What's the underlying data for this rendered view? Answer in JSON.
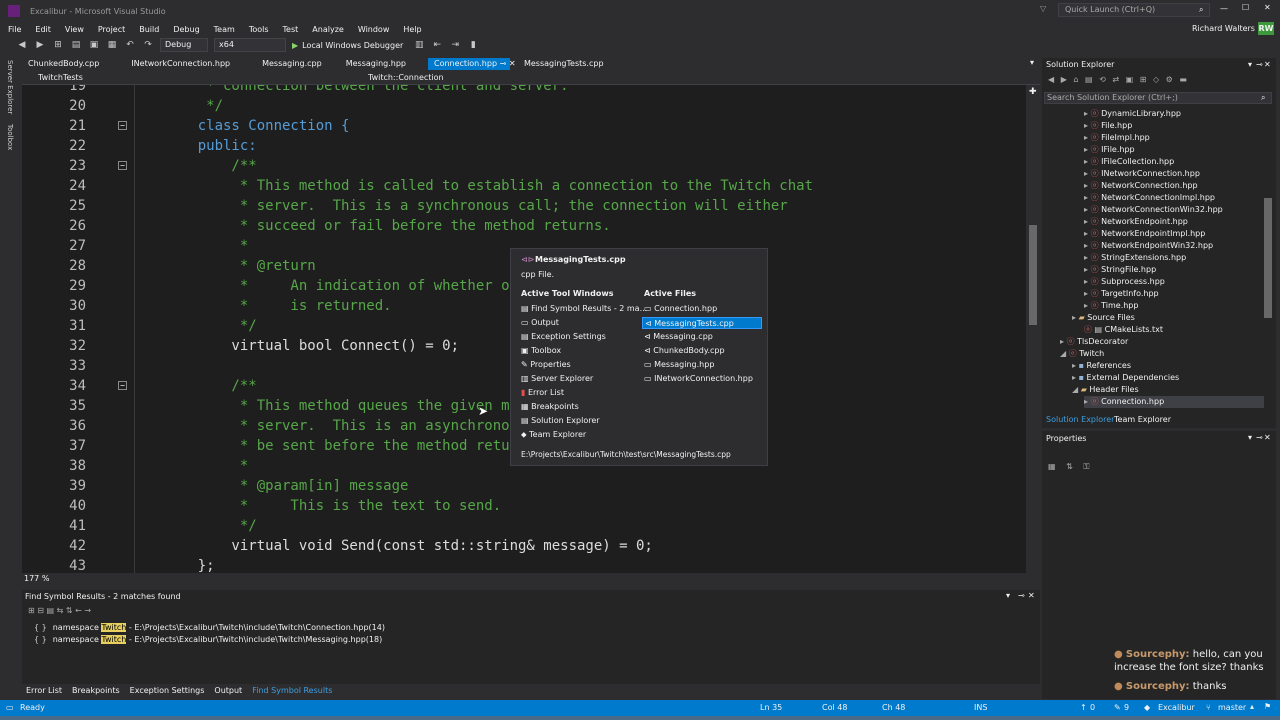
{
  "window": {
    "title": "Excalibur - Microsoft Visual Studio",
    "quick_launch": "Quick Launch (Ctrl+Q)",
    "user": "Richard Walters",
    "user_initials": "RW"
  },
  "menu": [
    "File",
    "Edit",
    "View",
    "Project",
    "Build",
    "Debug",
    "Team",
    "Tools",
    "Test",
    "Analyze",
    "Window",
    "Help"
  ],
  "toolbar": {
    "config": "Debug",
    "platform": "x64",
    "run": "Local Windows Debugger"
  },
  "left_strip": [
    "Server Explorer",
    "Toolbox"
  ],
  "doc_tabs": [
    {
      "label": "ChunkedBody.cpp",
      "active": false
    },
    {
      "label": "INetworkConnection.hpp",
      "active": false
    },
    {
      "label": "Messaging.cpp",
      "active": false
    },
    {
      "label": "Messaging.hpp",
      "active": false
    },
    {
      "label": "Connection.hpp",
      "active": true
    },
    {
      "label": "MessagingTests.cpp",
      "active": false
    }
  ],
  "nav": {
    "project": "TwitchTests",
    "scope": "Twitch::Connection"
  },
  "editor_lines": [
    {
      "n": "19",
      "t": "     * connection between the client and server."
    },
    {
      "n": "20",
      "t": "     */"
    },
    {
      "n": "21",
      "t": "    class Connection {"
    },
    {
      "n": "22",
      "t": "    public:"
    },
    {
      "n": "23",
      "t": "        /**"
    },
    {
      "n": "24",
      "t": "         * This method is called to establish a connection to the Twitch chat"
    },
    {
      "n": "25",
      "t": "         * server.  This is a synchronous call; the connection will either"
    },
    {
      "n": "26",
      "t": "         * succeed or fail before the method returns."
    },
    {
      "n": "27",
      "t": "         *"
    },
    {
      "n": "28",
      "t": "         * @return"
    },
    {
      "n": "29",
      "t": "         *     An indication of whether or no"
    },
    {
      "n": "30",
      "t": "         *     is returned."
    },
    {
      "n": "31",
      "t": "         */"
    },
    {
      "n": "32",
      "t": "        virtual bool Connect() = 0;"
    },
    {
      "n": "33",
      "t": ""
    },
    {
      "n": "34",
      "t": "        /**"
    },
    {
      "n": "35",
      "t": "         * This method queues the given messa"
    },
    {
      "n": "36",
      "t": "         * server.  This is an asynchronous c"
    },
    {
      "n": "37",
      "t": "         * be sent before the method returns."
    },
    {
      "n": "38",
      "t": "         *"
    },
    {
      "n": "39",
      "t": "         * @param[in] message"
    },
    {
      "n": "40",
      "t": "         *     This is the text to send."
    },
    {
      "n": "41",
      "t": "         */"
    },
    {
      "n": "42",
      "t": "        virtual void Send(const std::string& message) = 0;"
    },
    {
      "n": "43",
      "t": "    };"
    }
  ],
  "zoom": "177 %",
  "find_results": {
    "title": "Find Symbol Results - 2 matches found",
    "rows": [
      {
        "pre": "namespace ",
        "hl": "Twitch",
        "post": " - E:\\Projects\\Excalibur\\Twitch\\include\\Twitch\\Connection.hpp(14)"
      },
      {
        "pre": "namespace ",
        "hl": "Twitch",
        "post": " - E:\\Projects\\Excalibur\\Twitch\\include\\Twitch\\Messaging.hpp(18)"
      }
    ]
  },
  "bottom_tabs": [
    "Error List",
    "Breakpoints",
    "Exception Settings",
    "Output",
    "Find Symbol Results"
  ],
  "solution_explorer": {
    "title": "Solution Explorer",
    "search": "Search Solution Explorer (Ctrl+;)",
    "items": [
      {
        "label": "DynamicLibrary.hpp",
        "indent": 4
      },
      {
        "label": "File.hpp",
        "indent": 4
      },
      {
        "label": "FileImpl.hpp",
        "indent": 4
      },
      {
        "label": "IFile.hpp",
        "indent": 4
      },
      {
        "label": "IFileCollection.hpp",
        "indent": 4
      },
      {
        "label": "INetworkConnection.hpp",
        "indent": 4
      },
      {
        "label": "NetworkConnection.hpp",
        "indent": 4
      },
      {
        "label": "NetworkConnectionImpl.hpp",
        "indent": 4
      },
      {
        "label": "NetworkConnectionWin32.hpp",
        "indent": 4
      },
      {
        "label": "NetworkEndpoint.hpp",
        "indent": 4
      },
      {
        "label": "NetworkEndpointImpl.hpp",
        "indent": 4
      },
      {
        "label": "NetworkEndpointWin32.hpp",
        "indent": 4
      },
      {
        "label": "StringExtensions.hpp",
        "indent": 4
      },
      {
        "label": "StringFile.hpp",
        "indent": 4
      },
      {
        "label": "Subprocess.hpp",
        "indent": 4
      },
      {
        "label": "TargetInfo.hpp",
        "indent": 4
      },
      {
        "label": "Time.hpp",
        "indent": 4
      },
      {
        "label": "Source Files",
        "indent": 3
      },
      {
        "label": "CMakeLists.txt",
        "indent": 3
      },
      {
        "label": "TlsDecorator",
        "indent": 2
      },
      {
        "label": "Twitch",
        "indent": 2
      },
      {
        "label": "References",
        "indent": 3
      },
      {
        "label": "External Dependencies",
        "indent": 3
      },
      {
        "label": "Header Files",
        "indent": 3
      },
      {
        "label": "Connection.hpp",
        "indent": 4
      }
    ],
    "tabs": [
      "Solution Explorer",
      "Team Explorer"
    ]
  },
  "properties": {
    "title": "Properties"
  },
  "popup": {
    "title": "MessagingTests.cpp",
    "subtitle": "cpp File.",
    "tools_header": "Active Tool Windows",
    "files_header": "Active Files",
    "tools": [
      "Find Symbol Results - 2 ma...",
      "Output",
      "Exception Settings",
      "Toolbox",
      "Properties",
      "Server Explorer",
      "Error List",
      "Breakpoints",
      "Solution Explorer",
      "Team Explorer"
    ],
    "files": [
      "Connection.hpp",
      "MessagingTests.cpp",
      "Messaging.cpp",
      "ChunkedBody.cpp",
      "Messaging.hpp",
      "INetworkConnection.hpp"
    ],
    "path": "E:\\Projects\\Excalibur\\Twitch\\test\\src\\MessagingTests.cpp"
  },
  "chat": [
    {
      "user": "Sourcephy:",
      "msg": " hello, can you increase the font size? thanks"
    },
    {
      "user": "Sourcephy:",
      "msg": " thanks"
    }
  ],
  "status": {
    "ready": "Ready",
    "ln": "Ln 35",
    "col": "Col 48",
    "ch": "Ch 48",
    "ins": "INS",
    "up": "0",
    "edits": "9",
    "repo": "Excalibur",
    "branch": "master"
  }
}
